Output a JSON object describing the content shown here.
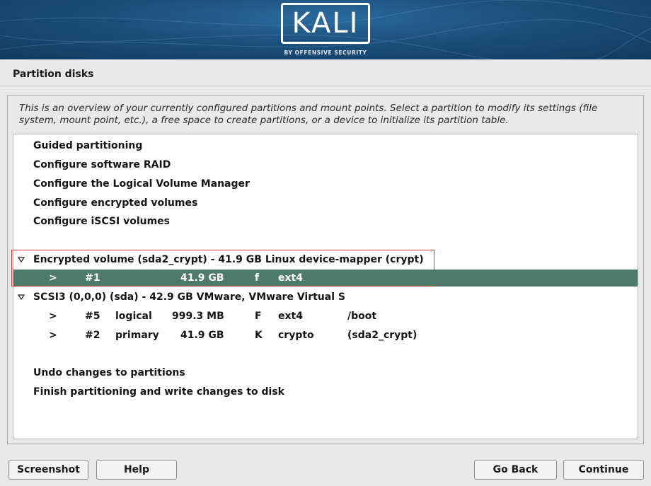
{
  "banner": {
    "logo_text": "KALI",
    "logo_sub": "BY OFFENSIVE SECURITY"
  },
  "page_title": "Partition disks",
  "description": "This is an overview of your currently configured partitions and mount points. Select a partition to modify its settings (file system, mount point, etc.), a free space to create partitions, or a device to initialize its partition table.",
  "list": {
    "menu": [
      "Guided partitioning",
      "Configure software RAID",
      "Configure the Logical Volume Manager",
      "Configure encrypted volumes",
      "Configure iSCSI volumes"
    ],
    "encrypted_volume": "Encrypted volume (sda2_crypt) - 41.9 GB Linux device-mapper (crypt)",
    "encrypted_partition": {
      "arrow": ">",
      "num": "#1",
      "size": "41.9 GB",
      "flag": "f",
      "fs": "ext4"
    },
    "disk": "SCSI3 (0,0,0) (sda) - 42.9 GB VMware, VMware Virtual S",
    "disk_partitions": [
      {
        "arrow": ">",
        "num": "#5",
        "type": "logical",
        "size": "999.3 MB",
        "flag": "F",
        "fs": "ext4",
        "mount": "/boot"
      },
      {
        "arrow": ">",
        "num": "#2",
        "type": "primary",
        "size": "41.9 GB",
        "flag": "K",
        "fs": "crypto",
        "mount": "(sda2_crypt)"
      }
    ],
    "undo": "Undo changes to partitions",
    "finish": "Finish partitioning and write changes to disk"
  },
  "buttons": {
    "screenshot": "Screenshot",
    "help": "Help",
    "go_back": "Go Back",
    "continue": "Continue"
  },
  "colors": {
    "banner": "#1c4f7c",
    "selected_row": "#4e7a6b",
    "highlight_box": "#d83a3a"
  }
}
